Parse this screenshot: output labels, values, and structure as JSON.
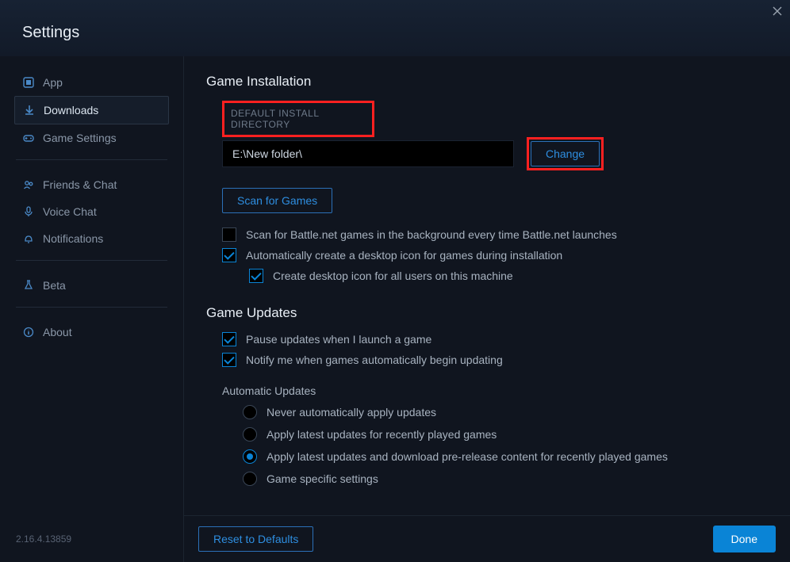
{
  "window": {
    "title": "Settings"
  },
  "sidebar": {
    "items": [
      {
        "label": "App"
      },
      {
        "label": "Downloads"
      },
      {
        "label": "Game Settings"
      },
      {
        "label": "Friends & Chat"
      },
      {
        "label": "Voice Chat"
      },
      {
        "label": "Notifications"
      },
      {
        "label": "Beta"
      },
      {
        "label": "About"
      }
    ],
    "version": "2.16.4.13859"
  },
  "content": {
    "game_installation": {
      "heading": "Game Installation",
      "default_dir_label": "DEFAULT INSTALL DIRECTORY",
      "default_dir_value": "E:\\New folder\\",
      "change_label": "Change",
      "scan_label": "Scan for Games",
      "checkboxes": [
        {
          "label": "Scan for Battle.net games in the background every time Battle.net launches",
          "checked": false
        },
        {
          "label": "Automatically create a desktop icon for games during installation",
          "checked": true
        },
        {
          "label": "Create desktop icon for all users on this machine",
          "checked": true
        }
      ]
    },
    "game_updates": {
      "heading": "Game Updates",
      "checkboxes": [
        {
          "label": "Pause updates when I launch a game",
          "checked": true
        },
        {
          "label": "Notify me when games automatically begin updating",
          "checked": true
        }
      ],
      "auto_heading": "Automatic Updates",
      "radios": [
        {
          "label": "Never automatically apply updates",
          "selected": false
        },
        {
          "label": "Apply latest updates for recently played games",
          "selected": false
        },
        {
          "label": "Apply latest updates and download pre-release content for recently played games",
          "selected": true
        },
        {
          "label": "Game specific settings",
          "selected": false
        }
      ]
    }
  },
  "footer": {
    "reset_label": "Reset to Defaults",
    "done_label": "Done"
  }
}
